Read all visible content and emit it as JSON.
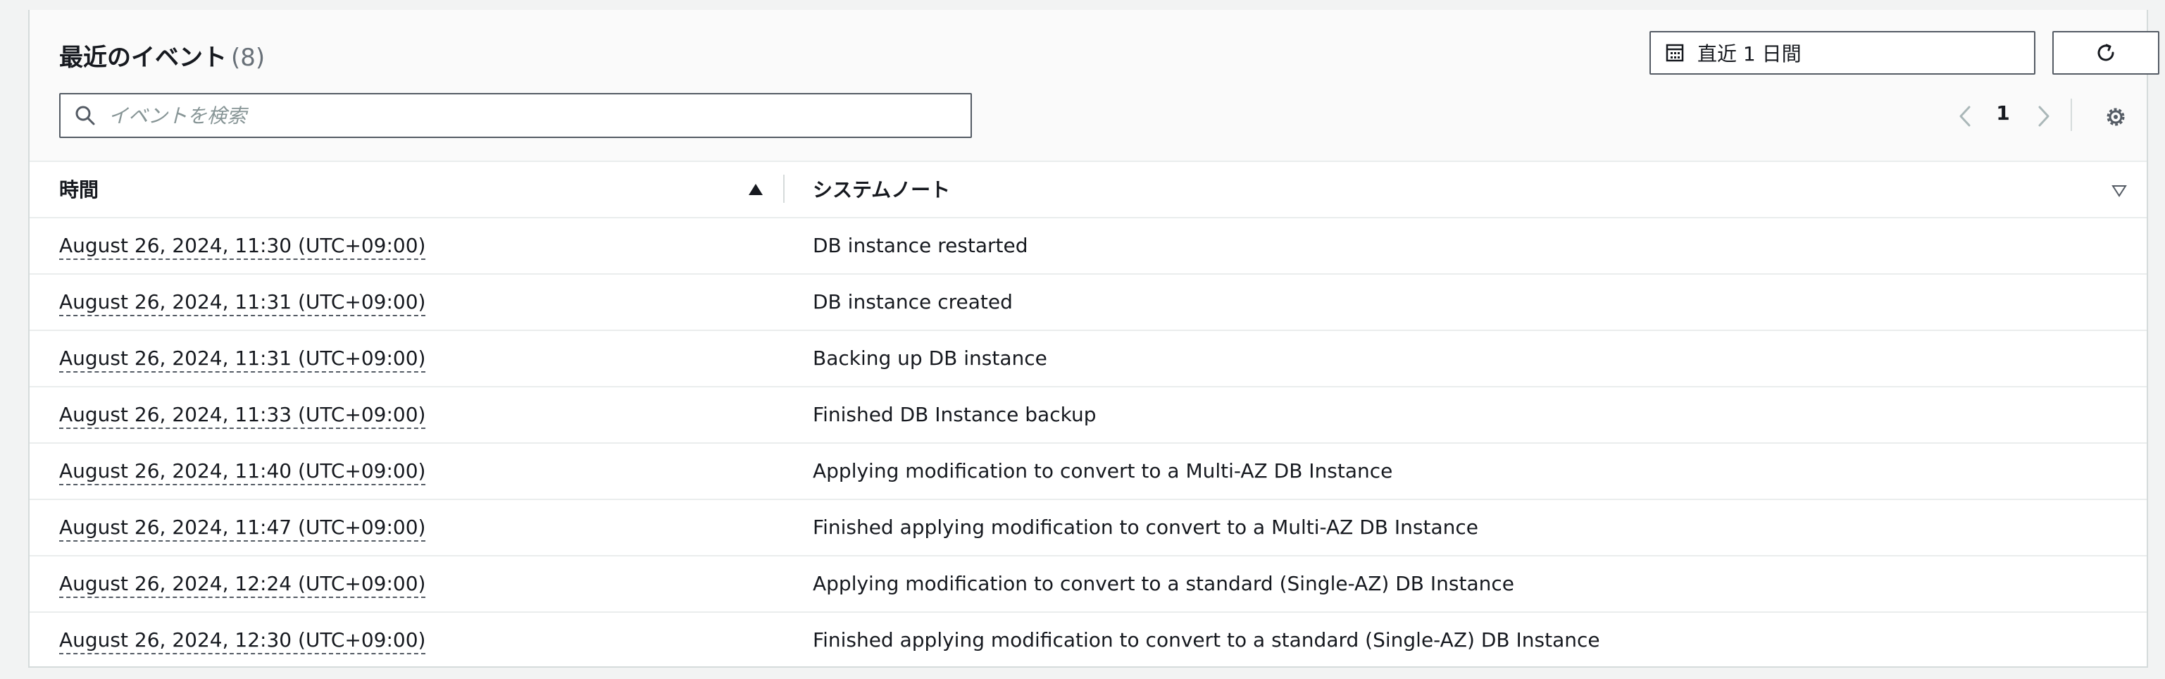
{
  "header": {
    "title": "最近のイベント",
    "count": "(8)",
    "time_range_label": "直近 1 日間"
  },
  "search": {
    "placeholder": "イベントを検索",
    "value": ""
  },
  "pagination": {
    "current_page": "1"
  },
  "table": {
    "columns": [
      "時間",
      "システムノート"
    ],
    "rows": [
      {
        "time": "August 26, 2024, 11:30 (UTC+09:00)",
        "note": "DB instance restarted"
      },
      {
        "time": "August 26, 2024, 11:31 (UTC+09:00)",
        "note": "DB instance created"
      },
      {
        "time": "August 26, 2024, 11:31 (UTC+09:00)",
        "note": "Backing up DB instance"
      },
      {
        "time": "August 26, 2024, 11:33 (UTC+09:00)",
        "note": "Finished DB Instance backup"
      },
      {
        "time": "August 26, 2024, 11:40 (UTC+09:00)",
        "note": "Applying modification to convert to a Multi-AZ DB Instance"
      },
      {
        "time": "August 26, 2024, 11:47 (UTC+09:00)",
        "note": "Finished applying modification to convert to a Multi-AZ DB Instance"
      },
      {
        "time": "August 26, 2024, 12:24 (UTC+09:00)",
        "note": "Applying modification to convert to a standard (Single-AZ) DB Instance"
      },
      {
        "time": "August 26, 2024, 12:30 (UTC+09:00)",
        "note": "Finished applying modification to convert to a standard (Single-AZ) DB Instance"
      }
    ]
  },
  "icons": {
    "calendar": "calendar-icon",
    "refresh": "refresh-icon",
    "search": "search-icon",
    "prev": "chevron-left-icon",
    "next": "chevron-right-icon",
    "settings": "gear-icon",
    "sort_asc": "sort-ascending-icon",
    "sort_none": "sort-unsorted-icon"
  },
  "colors": {
    "text": "#16191f",
    "muted": "#687078",
    "border": "#545b64",
    "divider": "#eaeded",
    "background": "#f2f3f3"
  }
}
